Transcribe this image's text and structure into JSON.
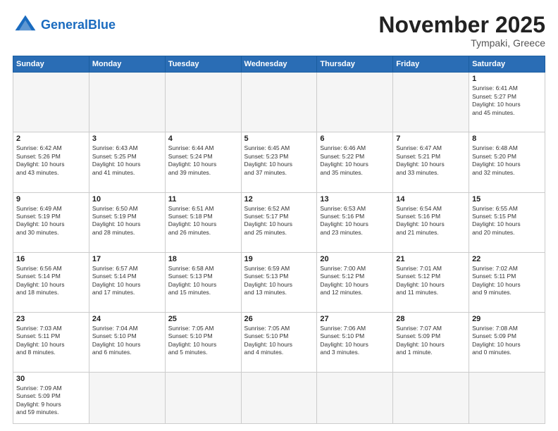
{
  "header": {
    "logo_general": "General",
    "logo_blue": "Blue",
    "month_title": "November 2025",
    "location": "Tympaki, Greece"
  },
  "weekdays": [
    "Sunday",
    "Monday",
    "Tuesday",
    "Wednesday",
    "Thursday",
    "Friday",
    "Saturday"
  ],
  "weeks": [
    [
      {
        "day": "",
        "info": ""
      },
      {
        "day": "",
        "info": ""
      },
      {
        "day": "",
        "info": ""
      },
      {
        "day": "",
        "info": ""
      },
      {
        "day": "",
        "info": ""
      },
      {
        "day": "",
        "info": ""
      },
      {
        "day": "1",
        "info": "Sunrise: 6:41 AM\nSunset: 5:27 PM\nDaylight: 10 hours\nand 45 minutes."
      }
    ],
    [
      {
        "day": "2",
        "info": "Sunrise: 6:42 AM\nSunset: 5:26 PM\nDaylight: 10 hours\nand 43 minutes."
      },
      {
        "day": "3",
        "info": "Sunrise: 6:43 AM\nSunset: 5:25 PM\nDaylight: 10 hours\nand 41 minutes."
      },
      {
        "day": "4",
        "info": "Sunrise: 6:44 AM\nSunset: 5:24 PM\nDaylight: 10 hours\nand 39 minutes."
      },
      {
        "day": "5",
        "info": "Sunrise: 6:45 AM\nSunset: 5:23 PM\nDaylight: 10 hours\nand 37 minutes."
      },
      {
        "day": "6",
        "info": "Sunrise: 6:46 AM\nSunset: 5:22 PM\nDaylight: 10 hours\nand 35 minutes."
      },
      {
        "day": "7",
        "info": "Sunrise: 6:47 AM\nSunset: 5:21 PM\nDaylight: 10 hours\nand 33 minutes."
      },
      {
        "day": "8",
        "info": "Sunrise: 6:48 AM\nSunset: 5:20 PM\nDaylight: 10 hours\nand 32 minutes."
      }
    ],
    [
      {
        "day": "9",
        "info": "Sunrise: 6:49 AM\nSunset: 5:19 PM\nDaylight: 10 hours\nand 30 minutes."
      },
      {
        "day": "10",
        "info": "Sunrise: 6:50 AM\nSunset: 5:19 PM\nDaylight: 10 hours\nand 28 minutes."
      },
      {
        "day": "11",
        "info": "Sunrise: 6:51 AM\nSunset: 5:18 PM\nDaylight: 10 hours\nand 26 minutes."
      },
      {
        "day": "12",
        "info": "Sunrise: 6:52 AM\nSunset: 5:17 PM\nDaylight: 10 hours\nand 25 minutes."
      },
      {
        "day": "13",
        "info": "Sunrise: 6:53 AM\nSunset: 5:16 PM\nDaylight: 10 hours\nand 23 minutes."
      },
      {
        "day": "14",
        "info": "Sunrise: 6:54 AM\nSunset: 5:16 PM\nDaylight: 10 hours\nand 21 minutes."
      },
      {
        "day": "15",
        "info": "Sunrise: 6:55 AM\nSunset: 5:15 PM\nDaylight: 10 hours\nand 20 minutes."
      }
    ],
    [
      {
        "day": "16",
        "info": "Sunrise: 6:56 AM\nSunset: 5:14 PM\nDaylight: 10 hours\nand 18 minutes."
      },
      {
        "day": "17",
        "info": "Sunrise: 6:57 AM\nSunset: 5:14 PM\nDaylight: 10 hours\nand 17 minutes."
      },
      {
        "day": "18",
        "info": "Sunrise: 6:58 AM\nSunset: 5:13 PM\nDaylight: 10 hours\nand 15 minutes."
      },
      {
        "day": "19",
        "info": "Sunrise: 6:59 AM\nSunset: 5:13 PM\nDaylight: 10 hours\nand 13 minutes."
      },
      {
        "day": "20",
        "info": "Sunrise: 7:00 AM\nSunset: 5:12 PM\nDaylight: 10 hours\nand 12 minutes."
      },
      {
        "day": "21",
        "info": "Sunrise: 7:01 AM\nSunset: 5:12 PM\nDaylight: 10 hours\nand 11 minutes."
      },
      {
        "day": "22",
        "info": "Sunrise: 7:02 AM\nSunset: 5:11 PM\nDaylight: 10 hours\nand 9 minutes."
      }
    ],
    [
      {
        "day": "23",
        "info": "Sunrise: 7:03 AM\nSunset: 5:11 PM\nDaylight: 10 hours\nand 8 minutes."
      },
      {
        "day": "24",
        "info": "Sunrise: 7:04 AM\nSunset: 5:10 PM\nDaylight: 10 hours\nand 6 minutes."
      },
      {
        "day": "25",
        "info": "Sunrise: 7:05 AM\nSunset: 5:10 PM\nDaylight: 10 hours\nand 5 minutes."
      },
      {
        "day": "26",
        "info": "Sunrise: 7:05 AM\nSunset: 5:10 PM\nDaylight: 10 hours\nand 4 minutes."
      },
      {
        "day": "27",
        "info": "Sunrise: 7:06 AM\nSunset: 5:10 PM\nDaylight: 10 hours\nand 3 minutes."
      },
      {
        "day": "28",
        "info": "Sunrise: 7:07 AM\nSunset: 5:09 PM\nDaylight: 10 hours\nand 1 minute."
      },
      {
        "day": "29",
        "info": "Sunrise: 7:08 AM\nSunset: 5:09 PM\nDaylight: 10 hours\nand 0 minutes."
      }
    ],
    [
      {
        "day": "30",
        "info": "Sunrise: 7:09 AM\nSunset: 5:09 PM\nDaylight: 9 hours\nand 59 minutes."
      },
      {
        "day": "",
        "info": ""
      },
      {
        "day": "",
        "info": ""
      },
      {
        "day": "",
        "info": ""
      },
      {
        "day": "",
        "info": ""
      },
      {
        "day": "",
        "info": ""
      },
      {
        "day": "",
        "info": ""
      }
    ]
  ]
}
